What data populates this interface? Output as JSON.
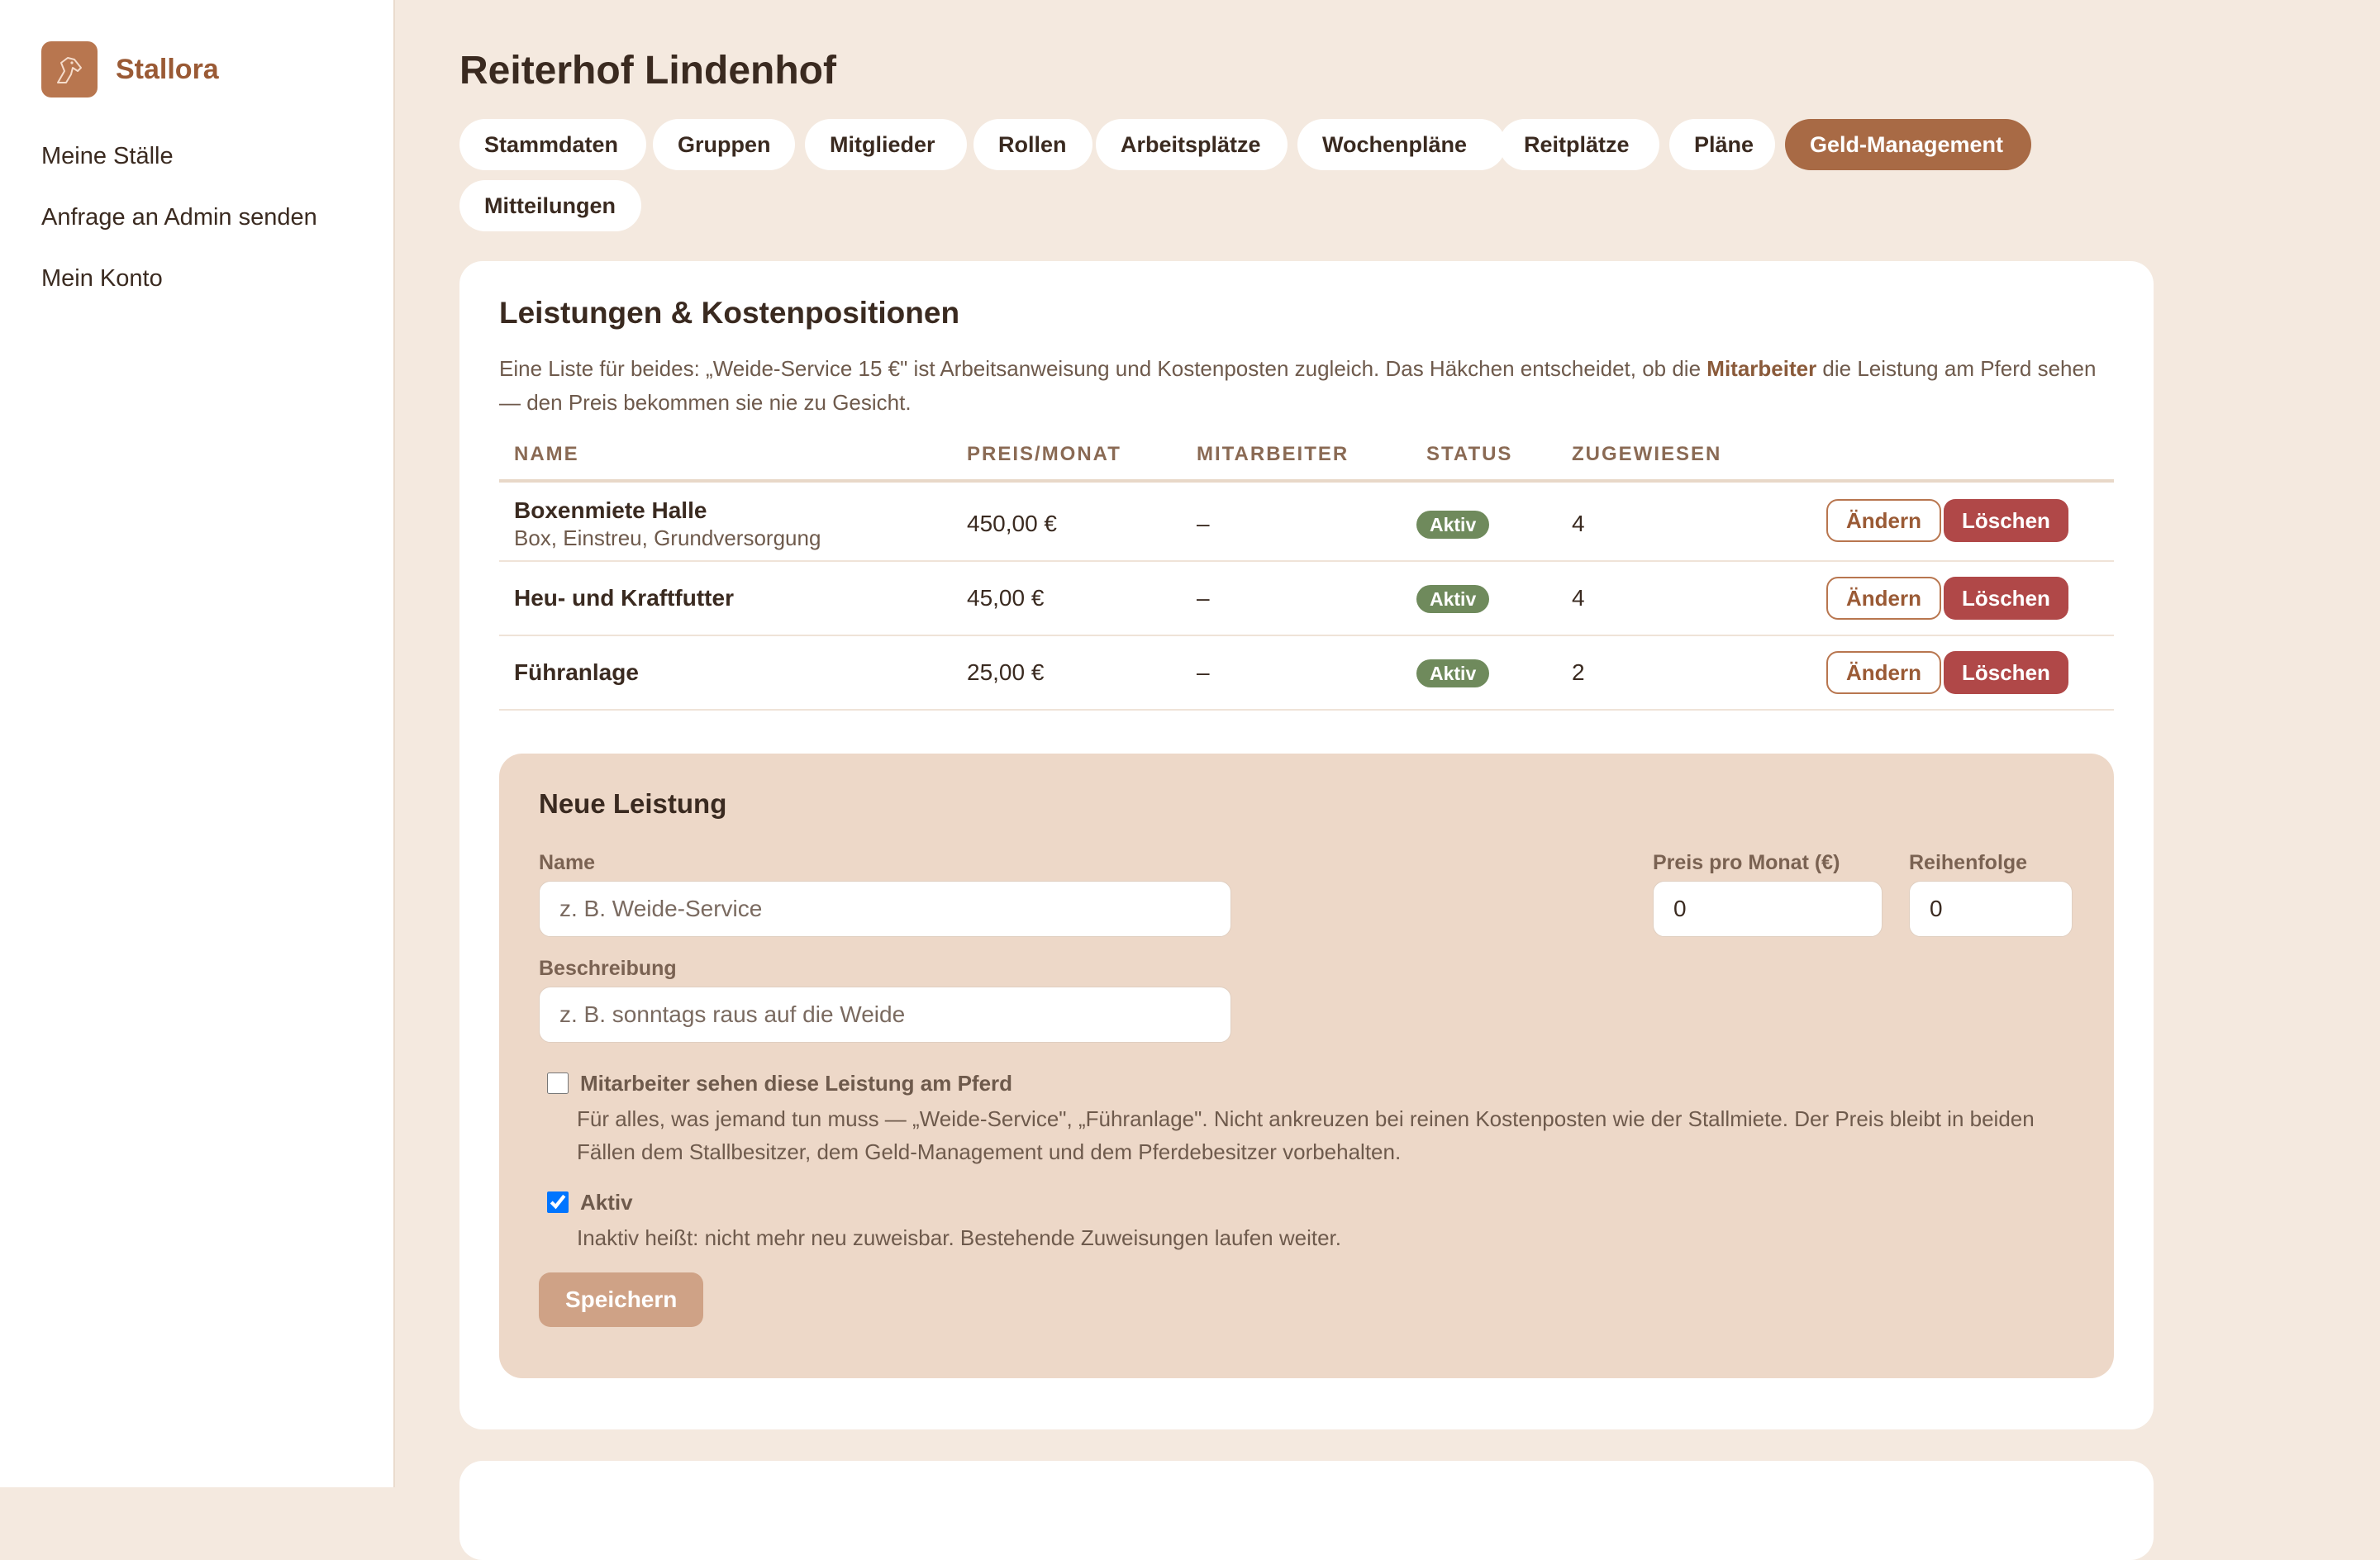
{
  "brand": {
    "name": "Stallora",
    "logo_icon": "horse-icon"
  },
  "sidebar": {
    "items": [
      {
        "label": "Meine Ställe"
      },
      {
        "label": "Anfrage an Admin senden"
      },
      {
        "label": "Mein Konto"
      }
    ]
  },
  "page": {
    "title": "Reiterhof Lindenhof"
  },
  "tabs": [
    {
      "label": "Stammdaten",
      "active": false
    },
    {
      "label": "Gruppen",
      "active": false
    },
    {
      "label": "Mitglieder",
      "active": false
    },
    {
      "label": "Rollen",
      "active": false
    },
    {
      "label": "Arbeitsplätze",
      "active": false
    },
    {
      "label": "Wochenpläne",
      "active": false
    },
    {
      "label": "Reitplätze",
      "active": false
    },
    {
      "label": "Pläne",
      "active": false
    },
    {
      "label": "Geld-Management",
      "active": true
    },
    {
      "label": "Mitteilungen",
      "active": false
    }
  ],
  "card": {
    "title": "Leistungen & Kostenpositionen",
    "intro_before": "Eine Liste für beides: „Weide-Service 15 €\" ist Arbeitsanweisung und Kostenposten zugleich. Das Häkchen entscheidet, ob die ",
    "intro_bold": "Mitarbeiter",
    "intro_after": " die Leistung am Pferd sehen — den Preis bekommen sie nie zu Gesicht."
  },
  "table": {
    "headers": {
      "name": "NAME",
      "price": "PREIS/MONAT",
      "staff": "MITARBEITER",
      "status": "STATUS",
      "assigned": "ZUGEWIESEN"
    },
    "rows": [
      {
        "name": "Boxenmiete Halle",
        "description": "Box, Einstreu, Grundversorgung",
        "price": "450,00 €",
        "staff": "–",
        "status": "Aktiv",
        "assigned": "4",
        "edit": "Ändern",
        "delete": "Löschen"
      },
      {
        "name": "Heu- und Kraftfutter",
        "description": "",
        "price": "45,00 €",
        "staff": "–",
        "status": "Aktiv",
        "assigned": "4",
        "edit": "Ändern",
        "delete": "Löschen"
      },
      {
        "name": "Führanlage",
        "description": "",
        "price": "25,00 €",
        "staff": "–",
        "status": "Aktiv",
        "assigned": "2",
        "edit": "Ändern",
        "delete": "Löschen"
      }
    ]
  },
  "form": {
    "title": "Neue Leistung",
    "name_label": "Name",
    "name_placeholder": "z. B. Weide-Service",
    "price_label": "Preis pro Monat (€)",
    "price_value": "0",
    "order_label": "Reihenfolge",
    "order_value": "0",
    "description_label": "Beschreibung",
    "description_placeholder": "z. B. sonntags raus auf die Weide",
    "staff_visible_label": "Mitarbeiter sehen diese Leistung am Pferd",
    "staff_visible_checked": false,
    "staff_visible_help": "Für alles, was jemand tun muss — „Weide-Service\", „Führanlage\". Nicht ankreuzen bei reinen Kostenposten wie der Stallmiete. Der Preis bleibt in beiden Fällen dem Stallbesitzer, dem Geld-Management und dem Pferdebesitzer vorbehalten.",
    "active_label": "Aktiv",
    "active_checked": true,
    "active_help": "Inaktiv heißt: nicht mehr neu zuweisbar. Bestehende Zuweisungen laufen weiter.",
    "save_label": "Speichern"
  },
  "colors": {
    "accent": "#a86a45",
    "background": "#f4e9df",
    "status_active": "#6f8a5c",
    "delete": "#b04848"
  }
}
